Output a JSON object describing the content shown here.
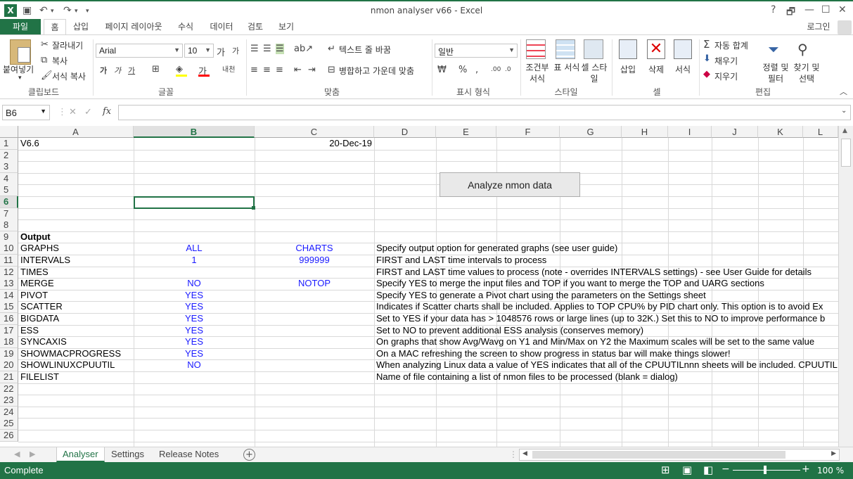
{
  "window": {
    "title": "nmon analyser v66 - Excel",
    "help": "?",
    "restore": "🗗",
    "minimize": "—",
    "maximize": "☐",
    "close": "✕"
  },
  "qat": {
    "undo": "↶",
    "redo": "↷",
    "save": "💾"
  },
  "tabs": [
    {
      "label": "파일"
    },
    {
      "label": "홈"
    },
    {
      "label": "삽입"
    },
    {
      "label": "페이지 레이아웃"
    },
    {
      "label": "수식"
    },
    {
      "label": "데이터"
    },
    {
      "label": "검토"
    },
    {
      "label": "보기"
    }
  ],
  "login": "로그인",
  "ribbon": {
    "clipboard": {
      "paste": "붙여넣기",
      "cut": "잘라내기",
      "copy": "복사",
      "format_painter": "서식 복사",
      "label": "클립보드"
    },
    "font": {
      "name": "Arial",
      "size": "10",
      "label": "글꼴"
    },
    "alignment": {
      "wrap": "텍스트 줄 바꿈",
      "merge": "병합하고 가운데 맞춤",
      "label": "맞춤"
    },
    "number": {
      "format": "일반",
      "percent": "%",
      "comma": ",",
      "label": "표시 형식"
    },
    "styles": {
      "conditional": "조건부 서식",
      "table": "표 서식",
      "cell": "셀 스타일",
      "label": "스타일"
    },
    "cells": {
      "insert": "삽입",
      "delete": "삭제",
      "format": "서식",
      "label": "셀"
    },
    "editing": {
      "autosum": "자동 합계",
      "fill": "채우기",
      "clear": "지우기",
      "sort": "정렬 및 필터",
      "find": "찾기 및 선택",
      "label": "편집"
    }
  },
  "formula_bar": {
    "name_box": "B6",
    "fx": "fx",
    "value": ""
  },
  "columns": [
    "A",
    "B",
    "C",
    "D",
    "E",
    "F",
    "G",
    "H",
    "I",
    "J",
    "K",
    "L"
  ],
  "rows": [
    "1",
    "2",
    "3",
    "4",
    "5",
    "6",
    "7",
    "8",
    "9",
    "10",
    "11",
    "12",
    "13",
    "14",
    "15",
    "16",
    "17",
    "18",
    "19",
    "20",
    "21",
    "22",
    "23",
    "24",
    "25",
    "26"
  ],
  "cells": {
    "A1": "V6.6",
    "C1": "20-Dec-19",
    "A9": "Output",
    "A10": "GRAPHS",
    "B10": "ALL",
    "C10": "CHARTS",
    "D10": "Specify output option for generated graphs (see user guide)",
    "A11": "INTERVALS",
    "B11": "1",
    "C11": "999999",
    "D11": "FIRST and LAST time intervals to process",
    "A12": "TIMES",
    "D12": "FIRST and LAST time values to process (note - overrides INTERVALS settings) - see User Guide for details",
    "A13": "MERGE",
    "B13": "NO",
    "C13": "NOTOP",
    "D13": "Specify YES to merge the input files and TOP if you want to merge the TOP and UARG sections",
    "A14": "PIVOT",
    "B14": "YES",
    "D14": "Specify YES to generate a Pivot chart using the parameters on the Settings sheet",
    "A15": "SCATTER",
    "B15": "YES",
    "D15": "Indicates if Scatter charts shall be included.  Applies to TOP CPU% by PID chart only.  This option is to avoid Ex",
    "A16": "BIGDATA",
    "B16": "YES",
    "D16": "Set to YES if your data has > 1048576 rows or large lines (up to 32K.)  Set this to NO to improve performance b",
    "A17": "ESS",
    "B17": "YES",
    "D17": "Set to NO to prevent additional ESS analysis (conserves memory)",
    "A18": "SYNCAXIS",
    "B18": "YES",
    "D18": "On graphs that show Avg/Wavg on Y1 and Min/Max on Y2 the Maximum scales will be set to the same value",
    "A19": "SHOWMACPROGRESS",
    "B19": "YES",
    "D19": "On a MAC refreshing the screen to show progress in status bar will make things slower!",
    "A20": "SHOWLINUXCPUUTIL",
    "B20": "NO",
    "D20": "When analyzing Linux data a value of YES indicates that all of the CPUUTILnnn sheets will be included.  CPUUTIL",
    "A21": "FILELIST",
    "D21": "Name of file containing a list of nmon files to be processed (blank = dialog)"
  },
  "analyze_button": "Analyze nmon data",
  "sheets": [
    {
      "label": "Analyser"
    },
    {
      "label": "Settings"
    },
    {
      "label": "Release Notes"
    }
  ],
  "add_sheet": "+",
  "status": {
    "text": "Complete",
    "zoom": "100 %"
  },
  "colors": {
    "accent": "#217346",
    "blue_text": "#1a1aff"
  }
}
